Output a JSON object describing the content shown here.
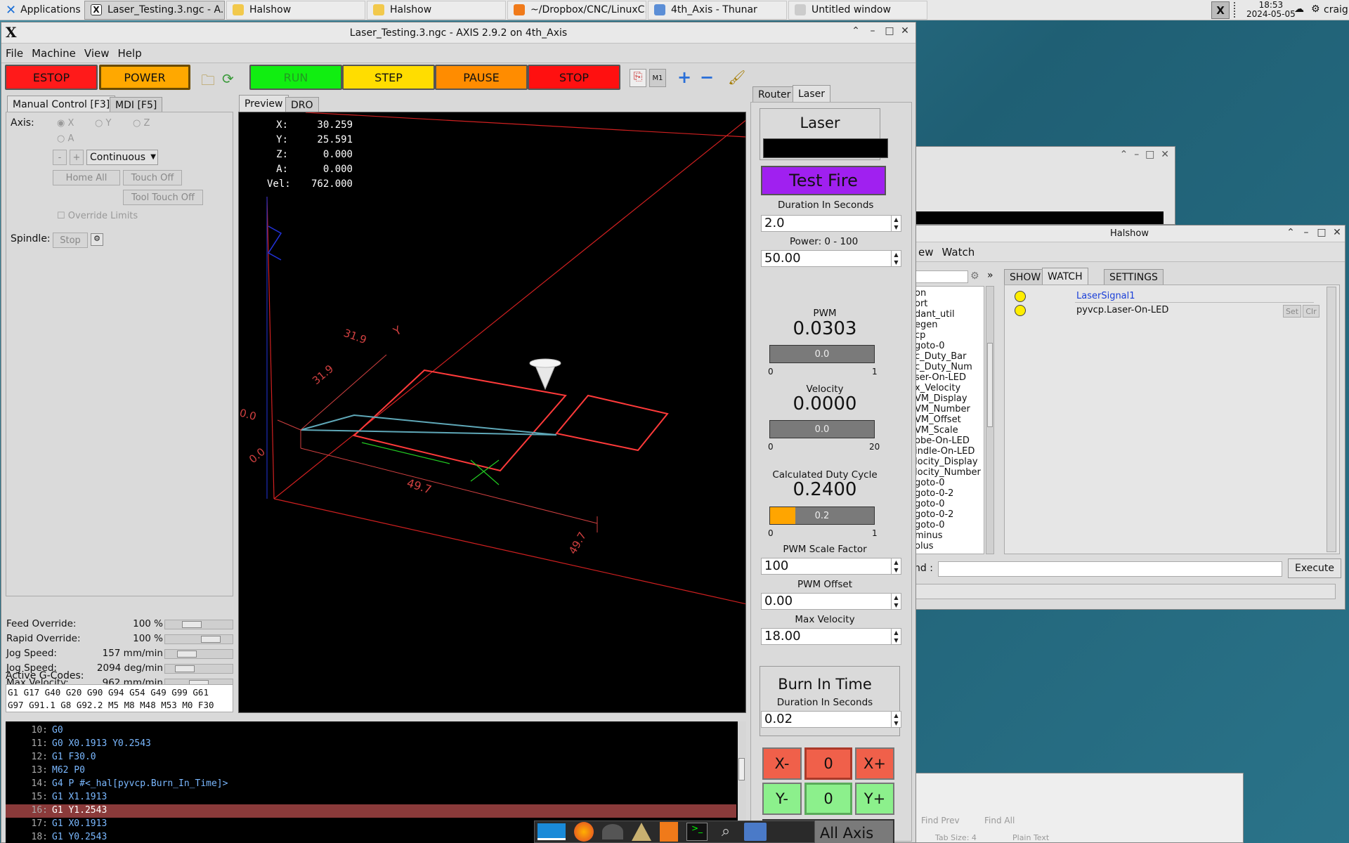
{
  "taskbar": {
    "apps_label": "Applications",
    "tasks": [
      "Laser_Testing.3.ngc - A...",
      "Halshow",
      "Halshow",
      "~/Dropbox/CNC/LinuxC...",
      "4th_Axis - Thunar",
      "Untitled window"
    ],
    "clock_time": "18:53",
    "clock_date": "2024-05-05",
    "user": "craig"
  },
  "axis": {
    "title": "Laser_Testing.3.ngc - AXIS 2.9.2 on 4th_Axis",
    "menu": [
      "File",
      "Machine",
      "View",
      "Help"
    ],
    "toolbar": {
      "estop": "ESTOP",
      "power": "POWER",
      "run": "RUN",
      "step": "STEP",
      "pause": "PAUSE",
      "stop": "STOP",
      "colors": {
        "estop": "#ff0000",
        "power": "#ffa000",
        "run": "#00ee00",
        "step": "#ffdd00",
        "pause": "#ff8c00",
        "stop": "#ff0000"
      }
    },
    "left_tabs": [
      "Manual Control [F3]",
      "MDI [F5]"
    ],
    "axis_label": "Axis:",
    "axes": [
      "X",
      "Y",
      "Z",
      "A"
    ],
    "minus": "-",
    "plus": "+",
    "jog_mode": "Continuous",
    "home_all": "Home All",
    "touch_off": "Touch Off",
    "tool_touch_off": "Tool Touch Off",
    "override_limits": "Override Limits",
    "spindle_label": "Spindle:",
    "spindle_stop": "Stop",
    "overrides": [
      {
        "label": "Feed Override:",
        "value": "100 %",
        "level": 0.35
      },
      {
        "label": "Rapid Override:",
        "value": "100 %",
        "level": 0.75
      },
      {
        "label": "Jog Speed:",
        "value": "157 mm/min",
        "level": 0.25
      },
      {
        "label": "Jog Speed:",
        "value": "2094 deg/min",
        "level": 0.2
      },
      {
        "label": "Max Velocity:",
        "value": "962 mm/min",
        "level": 0.5
      }
    ],
    "active_gcodes_label": "Active G-Codes:",
    "gcodes": [
      "G1 G17 G40 G20 G90 G94 G54 G49 G99 G61",
      "G97 G91.1 G8 G92.2 M5 M8 M48 M53 M0 F30"
    ],
    "preview_tabs": [
      "Preview",
      "DRO"
    ],
    "dro": [
      [
        "X:",
        "30.259"
      ],
      [
        "Y:",
        "25.591"
      ],
      [
        "Z:",
        "0.000"
      ],
      [
        "A:",
        "0.000"
      ],
      [
        "Vel:",
        "762.000"
      ]
    ],
    "dims": [
      "31.9",
      "31.9",
      "0.0",
      "0.0",
      "49.7",
      "49.7"
    ],
    "program": [
      {
        "n": "10:",
        "code": "G0"
      },
      {
        "n": "11:",
        "code": "G0 X0.1913 Y0.2543"
      },
      {
        "n": "12:",
        "code": "G1 F30.0"
      },
      {
        "n": "13:",
        "code": "M62 P0"
      },
      {
        "n": "14:",
        "code": "G4 P #<_hal[pyvcp.Burn_In_Time]>"
      },
      {
        "n": "15:",
        "code": "G1 X1.1913"
      },
      {
        "n": "16:",
        "code": "G1 Y1.2543"
      },
      {
        "n": "17:",
        "code": "G1 X0.1913"
      },
      {
        "n": "18:",
        "code": "G1 Y0.2543"
      }
    ]
  },
  "laser_panel": {
    "tabs": [
      "Router",
      "Laser"
    ],
    "title": "Laser",
    "test_fire": "Test Fire",
    "duration_label": "Duration In Seconds",
    "duration": "2.0",
    "power_label": "Power: 0 - 100",
    "power": "50.00",
    "pwm_label": "PWM",
    "pwm": "0.0303",
    "pwm_bar": {
      "text": "0.0",
      "min": "0",
      "max": "1",
      "fraction": 0
    },
    "velocity_label": "Velocity",
    "velocity": "0.0000",
    "velocity_bar": {
      "text": "0.0",
      "min": "0",
      "max": "20",
      "fraction": 0
    },
    "duty_label": "Calculated Duty Cycle",
    "duty": "0.2400",
    "duty_bar": {
      "text": "0.2",
      "min": "0",
      "max": "1",
      "fraction": 0.24
    },
    "scale_label": "PWM Scale Factor",
    "scale": "100",
    "offset_label": "PWM Offset",
    "offset": "0.00",
    "maxvel_label": "Max Velocity",
    "maxvel": "18.00",
    "burn_title": "Burn In Time",
    "burn_duration_label": "Duration In Seconds",
    "burn_duration": "0.02",
    "jog": {
      "xminus": "X-",
      "xval": "0",
      "xplus": "X+",
      "yminus": "Y-",
      "yval": "0",
      "yplus": "Y+"
    },
    "park": "Park All Axis"
  },
  "halshow": {
    "title": "Halshow",
    "menu": [
      "ew",
      "Watch"
    ],
    "tabs": [
      "SHOW",
      "WATCH",
      "SETTINGS"
    ],
    "tree": [
      "on",
      "ort",
      "dant_util",
      "egen",
      "cp",
      "goto-0",
      "c_Duty_Bar",
      "c_Duty_Num",
      "ser-On-LED",
      "x_Velocity",
      "VM_Display",
      "VM_Number",
      "VM_Offset",
      "VM_Scale",
      "obe-On-LED",
      "indle-On-LED",
      "locity_Display",
      "locity_Number",
      "goto-0",
      "goto-0-2",
      "goto-0",
      "goto-0-2",
      "goto-0",
      "minus",
      "olus"
    ],
    "watch": [
      "LaserSignal1",
      "pyvcp.Laser-On-LED"
    ],
    "set": "Set",
    "clr": "Clr",
    "cmd_label": "nd :",
    "execute": "Execute",
    "more": "»"
  },
  "background_window": {
    "find_prev": "Find Prev",
    "find_all": "Find All",
    "tab_size": "Tab Size: 4",
    "plain_text": "Plain Text"
  }
}
